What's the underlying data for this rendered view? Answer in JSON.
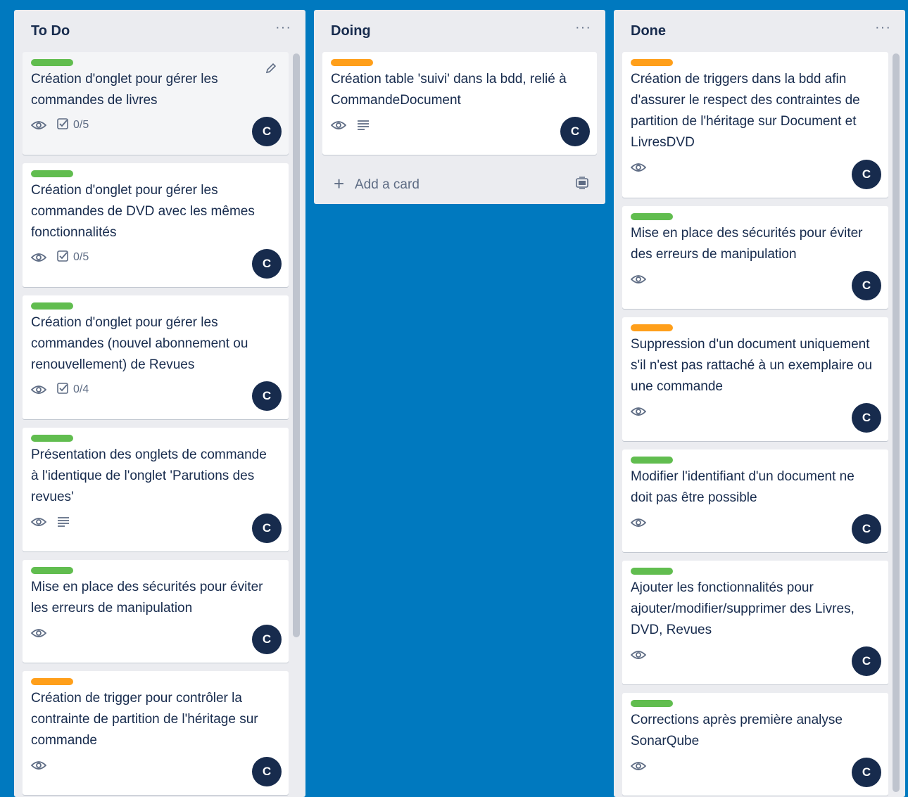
{
  "colors": {
    "background": "#0079bf",
    "green": "#61bd4f",
    "orange": "#ff9f1a",
    "avatar": "#172b4d"
  },
  "lists": [
    {
      "title": "To Do",
      "menu": "···",
      "cards": [
        {
          "label": "green",
          "title": "Création d'onglet pour gérer les commandes de livres",
          "watch": true,
          "checklist": "0/5",
          "avatar": "C"
        },
        {
          "label": "green",
          "title": "Création d'onglet pour gérer les commandes de DVD avec les mêmes fonctionnalités",
          "watch": true,
          "checklist": "0/5",
          "avatar": "C"
        },
        {
          "label": "green",
          "title": "Création d'onglet pour gérer les commandes (nouvel abonnement ou renouvellement) de Revues",
          "watch": true,
          "checklist": "0/4",
          "avatar": "C"
        },
        {
          "label": "green",
          "title": "Présentation des onglets de commande à l'identique de l'onglet 'Parutions des revues'",
          "watch": true,
          "description": true,
          "avatar": "C"
        },
        {
          "label": "green",
          "title": "Mise en place des sécurités pour éviter les erreurs de manipulation",
          "watch": true,
          "avatar": "C"
        },
        {
          "label": "orange",
          "title": "Création de trigger pour contrôler la contrainte de partition de l'héritage sur commande",
          "watch": true,
          "avatar": "C"
        }
      ]
    },
    {
      "title": "Doing",
      "menu": "···",
      "add_card": "Add a card",
      "cards": [
        {
          "label": "orange",
          "title": "Création table 'suivi' dans la bdd, relié à CommandeDocument",
          "watch": true,
          "description": true,
          "avatar": "C"
        }
      ]
    },
    {
      "title": "Done",
      "menu": "···",
      "cards": [
        {
          "label": "orange",
          "title": "Création de triggers dans la bdd afin d'assurer le respect des contraintes de partition de l'héritage sur Document et LivresDVD",
          "watch": true,
          "avatar": "C"
        },
        {
          "label": "green",
          "title": "Mise en place des sécurités pour éviter des erreurs de manipulation",
          "watch": true,
          "avatar": "C"
        },
        {
          "label": "orange",
          "title": "Suppression d'un document uniquement s'il n'est pas rattaché à un exemplaire ou une commande",
          "watch": true,
          "avatar": "C"
        },
        {
          "label": "green",
          "title": "Modifier l'identifiant d'un document ne doit pas être possible",
          "watch": true,
          "avatar": "C"
        },
        {
          "label": "green",
          "title": "Ajouter les fonctionnalités pour ajouter/modifier/supprimer des Livres, DVD, Revues",
          "watch": true,
          "avatar": "C"
        },
        {
          "label": "green",
          "title": "Corrections après première analyse SonarQube",
          "watch": true,
          "avatar": "C"
        }
      ]
    }
  ]
}
